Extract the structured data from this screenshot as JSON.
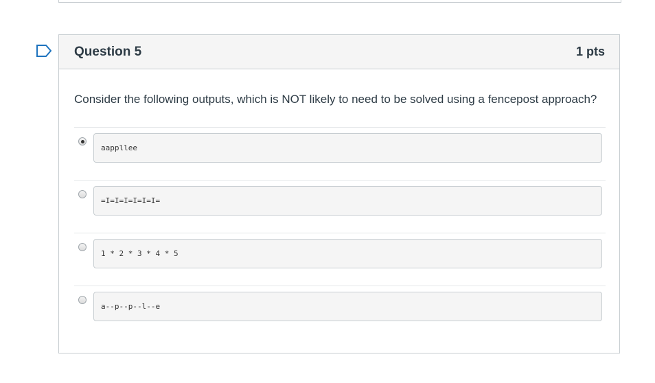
{
  "question": {
    "title": "Question 5",
    "points": "1 pts",
    "text": "Consider the following outputs, which is NOT likely to need to be solved using a fencepost approach?",
    "answers": [
      {
        "label": "aappllee",
        "selected": true
      },
      {
        "label": "=I=I=I=I=I=I=",
        "selected": false
      },
      {
        "label": "1 * 2 * 3 * 4 * 5",
        "selected": false
      },
      {
        "label": "a--p--p--l--e",
        "selected": false
      }
    ]
  },
  "colors": {
    "flag": "#1e73be",
    "border": "#c7cdd1",
    "header_bg": "#f5f5f5"
  },
  "icons": {
    "flag": "bookmark-flag-icon"
  }
}
